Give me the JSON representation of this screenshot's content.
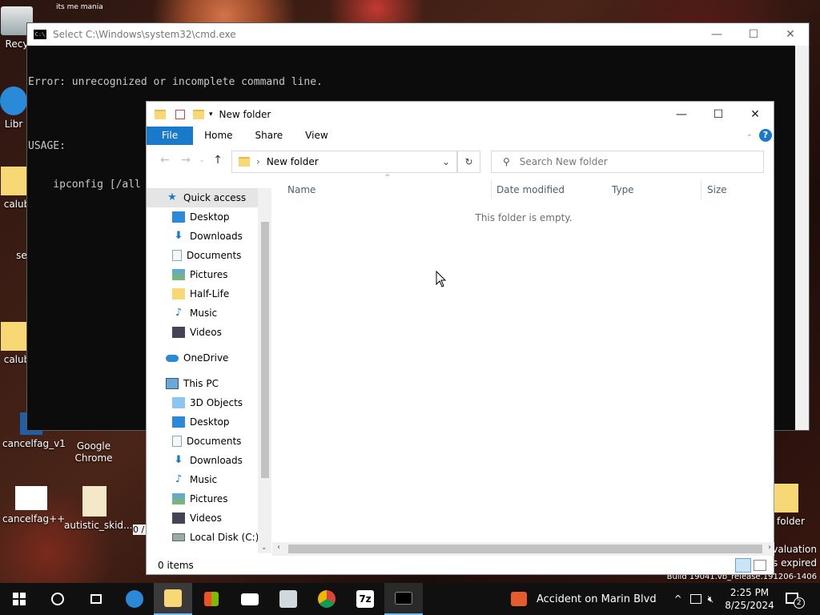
{
  "desktop": {
    "icons": [
      "Recy",
      "Libr",
      "calub",
      "se",
      "calub",
      "cancelfag_v1",
      "Google\nChrome",
      "cancelfag++",
      "autistic_skid...",
      "v folder"
    ],
    "top_snippet": "its me mania",
    "watermark": [
      "Evaluation",
      "is expired",
      "Build 19041.vb_release.191206-1406"
    ]
  },
  "cmd": {
    "title": "Select C:\\Windows\\system32\\cmd.exe",
    "badge": "C:\\",
    "lines": [
      "Error: unrecognized or incomplete command line.",
      "",
      "USAGE:",
      "    ipconfig [/all"
    ],
    "ctrls": [
      "—",
      "☐",
      "✕"
    ],
    "lower_left_text": "0 /"
  },
  "explorer": {
    "title": "New folder",
    "ctrls": [
      "—",
      "☐",
      "✕"
    ],
    "ribbon": {
      "file": "File",
      "tabs": [
        "Home",
        "Share",
        "View"
      ],
      "help": "?"
    },
    "address": {
      "path": "New folder",
      "sep": "›"
    },
    "search_placeholder": "Search New folder",
    "nav": [
      {
        "label": "Quick access",
        "kind": "star",
        "pinned": false,
        "selected": true
      },
      {
        "label": "Desktop",
        "kind": "desktop",
        "pinned": true
      },
      {
        "label": "Downloads",
        "kind": "down",
        "pinned": true
      },
      {
        "label": "Documents",
        "kind": "doc",
        "pinned": true
      },
      {
        "label": "Pictures",
        "kind": "pic",
        "pinned": true
      },
      {
        "label": "Half-Life",
        "kind": "folder",
        "pinned": false
      },
      {
        "label": "Music",
        "kind": "music",
        "pinned": false
      },
      {
        "label": "Videos",
        "kind": "video",
        "pinned": false
      },
      {
        "label": "",
        "kind": "gap"
      },
      {
        "label": "OneDrive",
        "kind": "cloud",
        "pinned": false
      },
      {
        "label": "",
        "kind": "gap"
      },
      {
        "label": "This PC",
        "kind": "pc",
        "pinned": false
      },
      {
        "label": "3D Objects",
        "kind": "obj3d",
        "pinned": false
      },
      {
        "label": "Desktop",
        "kind": "desktop",
        "pinned": false
      },
      {
        "label": "Documents",
        "kind": "doc",
        "pinned": false
      },
      {
        "label": "Downloads",
        "kind": "down",
        "pinned": false
      },
      {
        "label": "Music",
        "kind": "music",
        "pinned": false
      },
      {
        "label": "Pictures",
        "kind": "pic",
        "pinned": false
      },
      {
        "label": "Videos",
        "kind": "video",
        "pinned": false
      },
      {
        "label": "Local Disk (C:)",
        "kind": "disk",
        "pinned": false
      }
    ],
    "columns": [
      "Name",
      "Date modified",
      "Type",
      "Size"
    ],
    "empty_text": "This folder is empty.",
    "status": "0 items"
  },
  "taskbar": {
    "news": "Accident on Marin Blvd",
    "time": "2:25 PM",
    "date": "8/25/2024",
    "notif_count": "2",
    "seven_zip": "7z"
  },
  "colors": {
    "accent": "#1979ca",
    "taskbar": "#101010",
    "folder": "#f8d775"
  }
}
